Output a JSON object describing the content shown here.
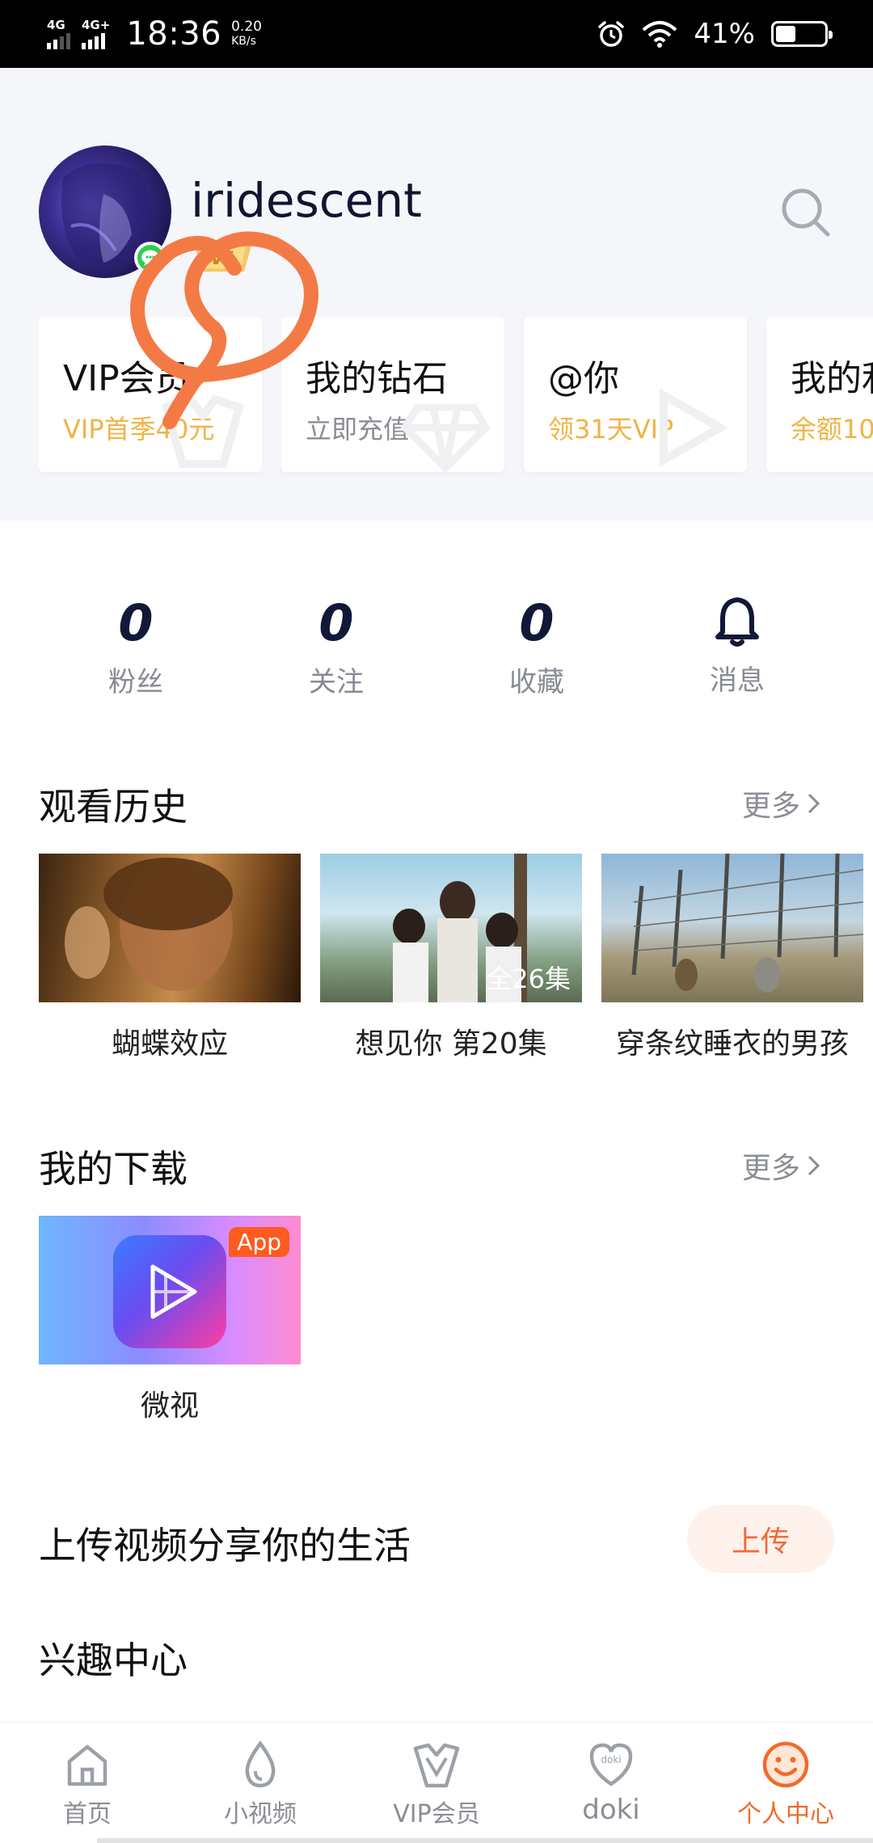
{
  "status_bar": {
    "signal1": "4G",
    "signal2": "4G+",
    "time": "18:36",
    "net_speed_value": "0.20",
    "net_speed_unit": "KB/s",
    "battery_percent": "41%",
    "battery_level": 0.41
  },
  "profile": {
    "username": "iridescent",
    "vip_badge_text": "V1"
  },
  "cards": [
    {
      "title": "VIP会员",
      "subtitle": "VIP首季40元",
      "subtitle_color": "#f0b445"
    },
    {
      "title": "我的钻石",
      "subtitle": "立即充值",
      "subtitle_color": "#8a8d95"
    },
    {
      "title": "@你",
      "subtitle": "领31天VIP",
      "subtitle_color": "#f0b445"
    },
    {
      "title": "我的利",
      "subtitle": "余额10",
      "subtitle_color": "#f0b445"
    }
  ],
  "stats": [
    {
      "value": "0",
      "label": "粉丝"
    },
    {
      "value": "0",
      "label": "关注"
    },
    {
      "value": "0",
      "label": "收藏"
    },
    {
      "icon": "bell-icon",
      "label": "消息"
    }
  ],
  "history": {
    "title": "观看历史",
    "more": "更多",
    "items": [
      {
        "title": "蝴蝶效应",
        "badge": ""
      },
      {
        "title": "想见你 第20集",
        "badge": "全26集"
      },
      {
        "title": "穿条纹睡衣的男孩",
        "badge": ""
      }
    ]
  },
  "downloads": {
    "title": "我的下载",
    "more": "更多",
    "items": [
      {
        "title": "微视",
        "tag": "App"
      }
    ]
  },
  "upload": {
    "title": "上传视频分享你的生活",
    "button": "上传"
  },
  "interest": {
    "title": "兴趣中心"
  },
  "nav": [
    {
      "label": "首页",
      "icon": "home-icon"
    },
    {
      "label": "小视频",
      "icon": "droplet-icon"
    },
    {
      "label": "VIP会员",
      "icon": "vip-crown-icon"
    },
    {
      "label": "doki",
      "icon": "doki-heart-icon"
    },
    {
      "label": "个人中心",
      "icon": "smiley-icon",
      "active": true
    }
  ],
  "colors": {
    "accent": "#f26a2c",
    "vip_gold": "#f0b445",
    "annotation": "#f47a45"
  }
}
